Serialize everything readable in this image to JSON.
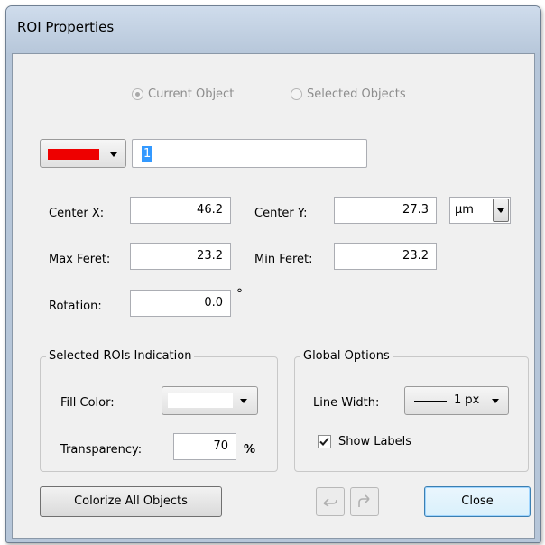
{
  "window": {
    "title": "ROI Properties"
  },
  "mode": {
    "current_object_label": "Current Object",
    "selected_objects_label": "Selected Objects",
    "selected": "Current Object"
  },
  "object": {
    "color": "#ee0000",
    "name": "1"
  },
  "measurements": {
    "center_x_label": "Center X:",
    "center_x": "46.2",
    "center_y_label": "Center Y:",
    "center_y": "27.3",
    "unit": "µm",
    "max_feret_label": "Max Feret:",
    "max_feret": "23.2",
    "min_feret_label": "Min Feret:",
    "min_feret": "23.2",
    "rotation_label": "Rotation:",
    "rotation": "0.0",
    "rotation_unit": "°"
  },
  "indication": {
    "title": "Selected ROIs Indication",
    "fill_color_label": "Fill Color:",
    "fill_color": "#ffffff",
    "transparency_label": "Transparency:",
    "transparency": "70",
    "transparency_unit": "%"
  },
  "global_options": {
    "title": "Global Options",
    "line_width_label": "Line Width:",
    "line_width": "1 px",
    "show_labels_label": "Show Labels",
    "show_labels": true
  },
  "buttons": {
    "colorize_all": "Colorize All Objects",
    "undo_icon": "undo-icon",
    "redo_icon": "redo-icon",
    "close": "Close"
  }
}
